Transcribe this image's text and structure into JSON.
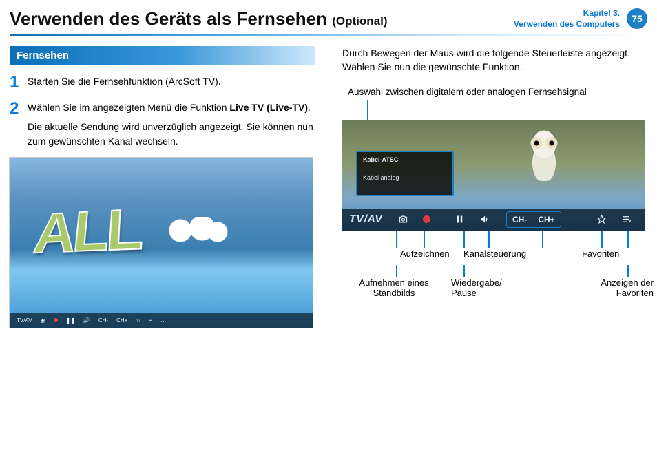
{
  "header": {
    "title": "Verwenden des Geräts als Fernsehen",
    "optional": "(Optional)",
    "chapter_line1": "Kapitel 3.",
    "chapter_line2": "Verwenden des Computers",
    "page_number": "75"
  },
  "section_heading": "Fernsehen",
  "steps": [
    {
      "num": "1",
      "text": "Starten Sie die Fernsehfunktion (ArcSoft TV)."
    },
    {
      "num": "2",
      "text_pre": "Wählen Sie im angezeigten Menü die Funktion ",
      "text_bold": "Live TV (Live-TV)",
      "text_post": ".",
      "sub": "Die aktuelle Sendung wird unverzüglich angezeigt. Sie können nun zum gewünschten Kanal wechseln."
    }
  ],
  "figure1": {
    "letters": "ALL",
    "bar": {
      "tvav": "TV/AV",
      "ch_minus": "CH-",
      "ch_plus": "CH+"
    }
  },
  "right": {
    "intro": "Durch Bewegen der Maus wird die folgende Steuerleiste angezeigt. Wählen Sie nun die gewünschte Funktion.",
    "signal_label": "Auswahl zwischen digitalem oder analogen Fernsehsignal"
  },
  "figure2": {
    "menu_item1": "Kabel-ATSC",
    "menu_item2": "Kabel analog",
    "tvav": "TV/AV",
    "ch_minus": "CH-",
    "ch_plus": "CH+"
  },
  "labels": {
    "row1": {
      "aufzeichnen": "Aufzeichnen",
      "kanalsteuerung": "Kanalsteuerung",
      "favoriten": "Favoriten"
    },
    "row2": {
      "standbild": "Aufnehmen eines Standbilds",
      "wiedergabe": "Wiedergabe/\nPause",
      "anzeigen": "Anzeigen der Favoriten"
    }
  }
}
